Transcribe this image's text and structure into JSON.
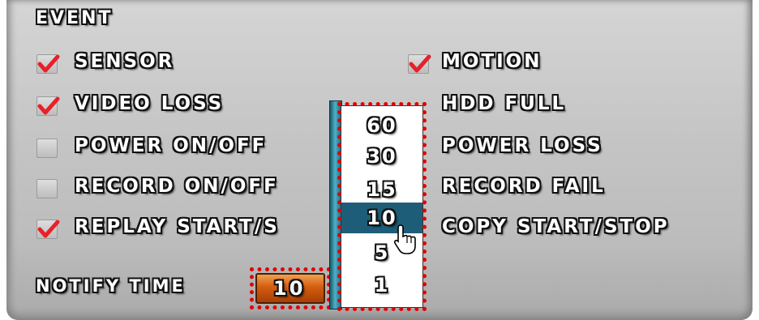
{
  "section_title": "EVENT",
  "left_items": [
    {
      "label": "SENSOR",
      "checked": true
    },
    {
      "label": "VIDEO LOSS",
      "checked": true
    },
    {
      "label": "POWER ON/OFF",
      "checked": false
    },
    {
      "label": "RECORD ON/OFF",
      "checked": false
    },
    {
      "label": "REPLAY START/S",
      "checked": true
    }
  ],
  "right_items": [
    {
      "label": "MOTION",
      "checked": true
    },
    {
      "label": "HDD FULL"
    },
    {
      "label": "POWER LOSS"
    },
    {
      "label": "RECORD FAIL"
    },
    {
      "label": "COPY START/STOP"
    }
  ],
  "notify": {
    "label": "NOTIFY TIME",
    "value": "10"
  },
  "dropdown": {
    "options": [
      "60",
      "30",
      "15",
      "10",
      "5",
      "1"
    ],
    "selected": "10"
  },
  "colors": {
    "check": "#e8202a",
    "selected_bg": "#1e5d78",
    "highlight": "#e00000",
    "value_bg": "#d45d10"
  }
}
